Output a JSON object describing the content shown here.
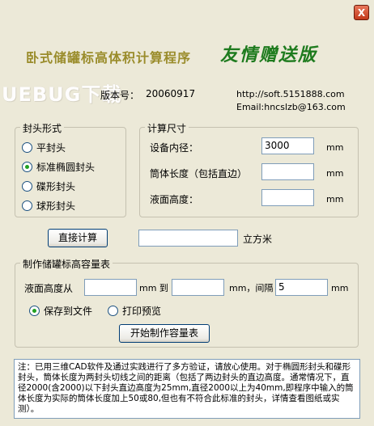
{
  "window": {
    "close_label": "X"
  },
  "header": {
    "title": "卧式储罐标高体积计算程序",
    "subtitle": "友情赠送版",
    "logo": "UEBUG下载",
    "version_label": "版本号：",
    "version": "20060917",
    "website": "http://soft.5151888.com",
    "email": "Email:hncslzb@163.com"
  },
  "head_type": {
    "title": "封头形式",
    "options": [
      {
        "label": "平封头",
        "selected": false
      },
      {
        "label": "标准椭圆封头",
        "selected": true
      },
      {
        "label": "碟形封头",
        "selected": false
      },
      {
        "label": "球形封头",
        "selected": false
      }
    ]
  },
  "calc_size": {
    "title": "计算尺寸",
    "fields": [
      {
        "label": "设备内径：",
        "value": "3000",
        "unit": "mm"
      },
      {
        "label": "筒体长度（包括直边）",
        "value": "",
        "unit": "mm"
      },
      {
        "label": "液面高度：",
        "value": "",
        "unit": "mm"
      }
    ]
  },
  "direct_calc": {
    "button": "直接计算",
    "result": "",
    "unit": "立方米"
  },
  "table_section": {
    "title": "制作储罐标高容量表",
    "from_label": "液面高度从",
    "from_value": "",
    "mm1": "mm 到",
    "to_value": "",
    "mm2": "mm，间隔",
    "step_value": "5",
    "mm3": "mm",
    "output_options": [
      {
        "label": "保存到文件",
        "selected": true
      },
      {
        "label": "打印预览",
        "selected": false
      }
    ],
    "start_button": "开始制作容量表"
  },
  "note": "注：已用三维CAD软件及通过实践进行了多方验证，请放心使用。对于椭圆形封头和碟形封头，筒体长度为两封头切线之间的距离（包括了两边封头的直边高度。通常情况下，直径2000(含2000)以下封头直边高度为25mm,直径2000以上为40mm,即程序中输入的筒体长度为实际的筒体长度加上50或80,但也有不符合此标准的封头，详情查看图纸或实测）。"
}
